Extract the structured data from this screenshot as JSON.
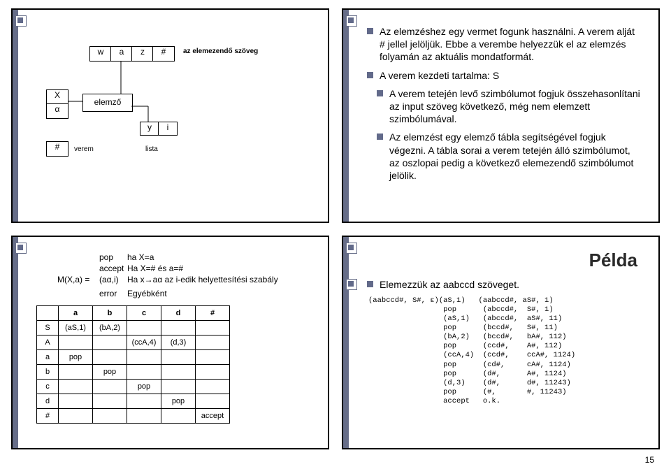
{
  "slide1": {
    "row": [
      "w",
      "a",
      "z",
      "#"
    ],
    "rowLabel": "az elemezendő szöveg",
    "col": [
      "X",
      "α",
      "#"
    ],
    "elemzo": "elemző",
    "yi": [
      "y",
      "i"
    ],
    "verem": "verem",
    "lista": "lista"
  },
  "slide2": {
    "bullets": [
      "Az elemzéshez egy vermet fogunk használni. A verem alját # jellel jelöljük. Ebbe a verembe helyezzük el az elemzés folyamán az aktuális mondatformát.",
      "A verem kezdeti tartalma: S",
      "A verem tetején levő szimbólumot fogjuk összehasonlítani az input szöveg következő, még nem elemzett szimbólumával.",
      "Az elemzést egy elemző tábla segítségével fogjuk végezni. A tábla sorai a verem tetején álló szimbólumot,  az oszlopai pedig a következő elemezendő szimbólumot jelölik."
    ]
  },
  "slide3": {
    "rows": [
      [
        "",
        "pop",
        "ha X=a"
      ],
      [
        "",
        "accept",
        "Ha X=# és a=#"
      ],
      [
        "M(X,a) =",
        "(aα,i)",
        "Ha x→aα az i-edik helyettesítési szabály"
      ],
      [
        "",
        "error",
        "Egyébként"
      ]
    ],
    "tab": {
      "cols": [
        "",
        "a",
        "b",
        "c",
        "d",
        "#"
      ],
      "body": [
        [
          "S",
          "(aS,1)",
          "(bA,2)",
          "",
          "",
          ""
        ],
        [
          "A",
          "",
          "",
          "(ccA,4)",
          "(d,3)",
          ""
        ],
        [
          "a",
          "pop",
          "",
          "",
          "",
          ""
        ],
        [
          "b",
          "",
          "pop",
          "",
          "",
          ""
        ],
        [
          "c",
          "",
          "",
          "pop",
          "",
          ""
        ],
        [
          "d",
          "",
          "",
          "",
          "pop",
          ""
        ],
        [
          "#",
          "",
          "",
          "",
          "",
          "accept"
        ]
      ]
    }
  },
  "slide4": {
    "title": "Példa",
    "lead": "Elemezzük az aabccd szöveget.",
    "trace": "(aabccd#, S#, ε)(aS,1)   (aabccd#, aS#, 1)\n                 pop      (abccd#,  S#, 1)\n                 (aS,1)   (abccd#,  aS#, 11)\n                 pop      (bccd#,   S#, 11)\n                 (bA,2)   (bccd#,   bA#, 112)\n                 pop      (ccd#,    A#, 112)\n                 (ccA,4)  (ccd#,    ccA#, 1124)\n                 pop      (cd#,     cA#, 1124)\n                 pop      (d#,      A#, 1124)\n                 (d,3)    (d#,      d#, 11243)\n                 pop      (#,       #, 11243)\n                 accept   o.k."
  },
  "page": "15"
}
